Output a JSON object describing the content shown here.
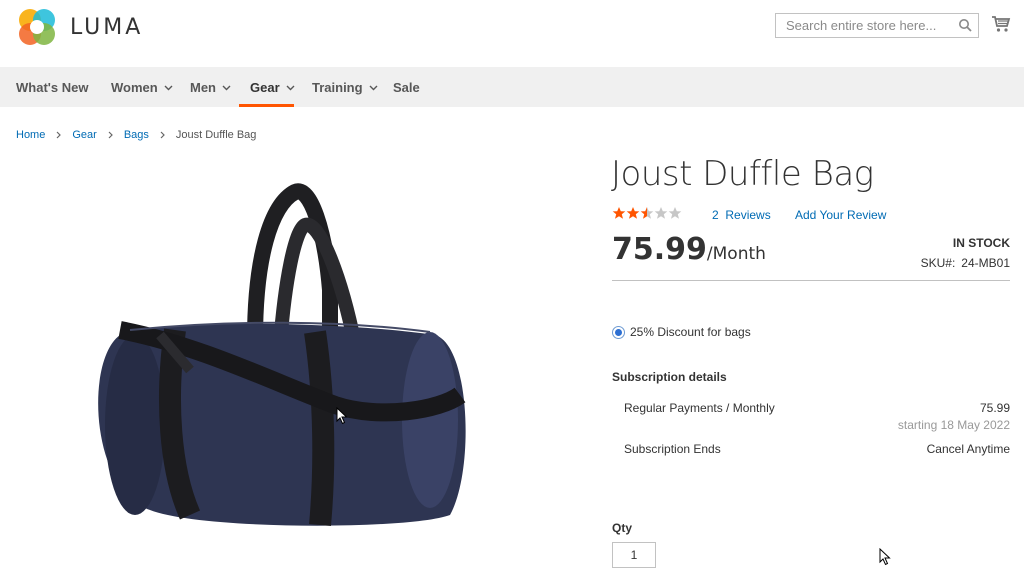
{
  "header": {
    "logo_text": "LUMA",
    "search_placeholder": "Search entire store here...",
    "icons": {
      "search": "search-icon",
      "cart": "cart-icon"
    }
  },
  "nav": {
    "items": [
      {
        "label": "What's New",
        "has_dropdown": false
      },
      {
        "label": "Women",
        "has_dropdown": true
      },
      {
        "label": "Men",
        "has_dropdown": true
      },
      {
        "label": "Gear",
        "has_dropdown": true,
        "active": true
      },
      {
        "label": "Training",
        "has_dropdown": true
      },
      {
        "label": "Sale",
        "has_dropdown": false
      }
    ],
    "active_underline_color": "#ff5501"
  },
  "breadcrumbs": [
    {
      "label": "Home",
      "link": true
    },
    {
      "label": "Gear",
      "link": true
    },
    {
      "label": "Bags",
      "link": true
    },
    {
      "label": "Joust Duffle Bag",
      "link": false
    }
  ],
  "product": {
    "title": "Joust Duffle Bag",
    "rating": 2.5,
    "rating_max": 5,
    "reviews_count": "2",
    "reviews_label": "Reviews",
    "add_review_label": "Add Your Review",
    "price": "75.99",
    "price_suffix": "/Month",
    "stock": "IN STOCK",
    "sku_label": "SKU#:",
    "sku": "24-MB01",
    "image_alt": "Joust Duffle Bag",
    "colors": {
      "star_filled": "#ff5501",
      "star_empty": "#c7c7c7",
      "link": "#006bb4"
    }
  },
  "subscription": {
    "discount_option": "25% Discount for bags",
    "details_title": "Subscription details",
    "rows": [
      {
        "label": "Regular Payments / Monthly",
        "value": "75.99",
        "sub": "starting 18 May 2022"
      },
      {
        "label": "Subscription Ends",
        "value": "Cancel Anytime"
      }
    ]
  },
  "qty": {
    "label": "Qty",
    "value": "1"
  }
}
